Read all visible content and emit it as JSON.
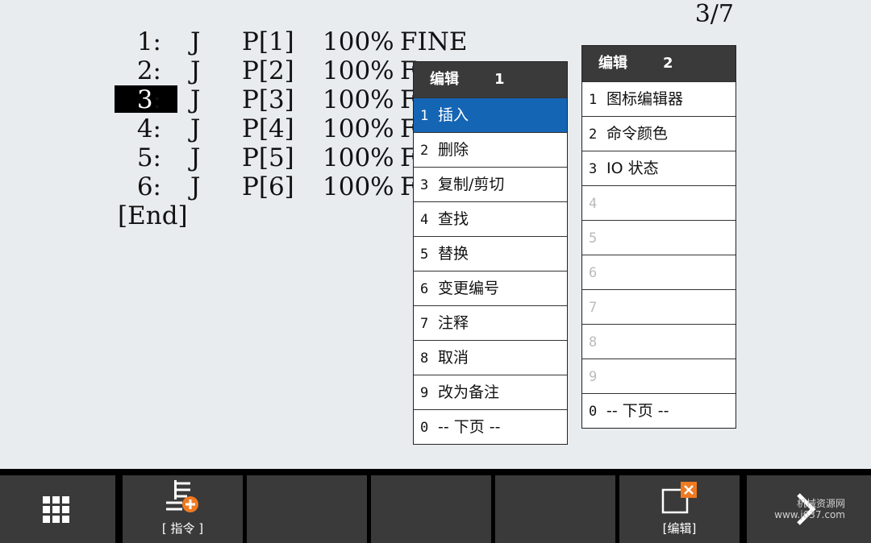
{
  "line_counter": "3/7",
  "program": {
    "lines": [
      {
        "num": "1:",
        "motion": "J",
        "pos": "P[1]",
        "speed": "100%",
        "term": "FINE"
      },
      {
        "num": "2:",
        "motion": "J",
        "pos": "P[2]",
        "speed": "100%",
        "term": "F"
      },
      {
        "num": "3:",
        "motion": "J",
        "pos": "P[3]",
        "speed": "100%",
        "term": "F"
      },
      {
        "num": "4:",
        "motion": "J",
        "pos": "P[4]",
        "speed": "100%",
        "term": "F"
      },
      {
        "num": "5:",
        "motion": "J",
        "pos": "P[5]",
        "speed": "100%",
        "term": "F"
      },
      {
        "num": "6:",
        "motion": "J",
        "pos": "P[6]",
        "speed": "100%",
        "term": "F"
      }
    ],
    "end": "[End]",
    "selected_line": "3"
  },
  "menu1": {
    "title": "编辑",
    "page": "1",
    "items": [
      {
        "n": "1",
        "label": "插入"
      },
      {
        "n": "2",
        "label": "删除"
      },
      {
        "n": "3",
        "label": "复制/剪切"
      },
      {
        "n": "4",
        "label": "查找"
      },
      {
        "n": "5",
        "label": "替换"
      },
      {
        "n": "6",
        "label": "变更编号"
      },
      {
        "n": "7",
        "label": "注释"
      },
      {
        "n": "8",
        "label": "取消"
      },
      {
        "n": "9",
        "label": "改为备注"
      },
      {
        "n": "0",
        "label": "-- 下页 --"
      }
    ]
  },
  "menu2": {
    "title": "编辑",
    "page": "2",
    "items": [
      {
        "n": "1",
        "label": "图标编辑器"
      },
      {
        "n": "2",
        "label": "命令颜色"
      },
      {
        "n": "3",
        "label": "IO 状态"
      },
      {
        "n": "4",
        "label": ""
      },
      {
        "n": "5",
        "label": ""
      },
      {
        "n": "6",
        "label": ""
      },
      {
        "n": "7",
        "label": ""
      },
      {
        "n": "8",
        "label": ""
      },
      {
        "n": "9",
        "label": ""
      },
      {
        "n": "0",
        "label": "-- 下页 --"
      }
    ]
  },
  "function_keys": {
    "f1": {
      "icon": "grid-menu-icon",
      "label": ""
    },
    "f2": {
      "icon": "instruction-add-icon",
      "label": "[ 指令 ]"
    },
    "f6": {
      "icon": "edit-close-icon",
      "label": "[编辑]"
    },
    "next": {
      "icon": "next-arrow-icon",
      "label": ""
    }
  },
  "watermark": {
    "line1": "机械资源网",
    "line2": "www.j637.com"
  },
  "colors": {
    "selection": "#1565b5",
    "menu_header": "#3a3a3a",
    "background": "#e9ecef",
    "fkey": "#3a3a3a",
    "accent_orange": "#f07a22"
  }
}
